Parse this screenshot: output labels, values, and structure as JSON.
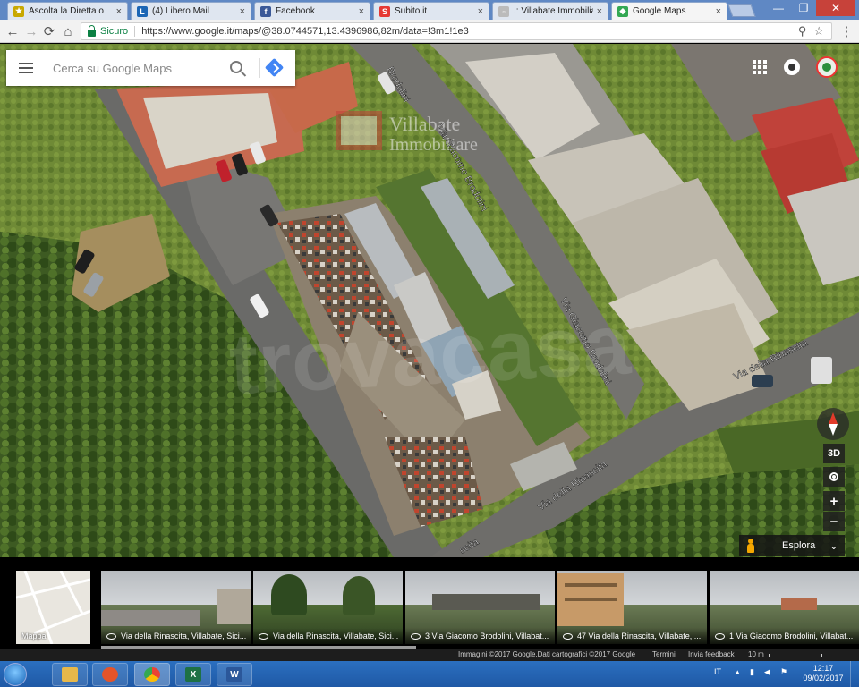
{
  "browser": {
    "tabs": [
      {
        "label": "Ascolta la Diretta o",
        "favicon_color": "#c8a800",
        "favicon_glyph": "★"
      },
      {
        "label": "(4) Libero Mail",
        "favicon_color": "#1c66b5",
        "favicon_glyph": "L"
      },
      {
        "label": "Facebook",
        "favicon_color": "#3b5998",
        "favicon_glyph": "f"
      },
      {
        "label": "Subito.it",
        "favicon_color": "#e53935",
        "favicon_glyph": "S"
      },
      {
        "label": ".: Villabate Immobilia",
        "favicon_color": "#bbbbbb",
        "favicon_glyph": "▫"
      },
      {
        "label": "Google Maps",
        "favicon_color": "#34a853",
        "favicon_glyph": "◆"
      }
    ],
    "tab_close_glyph": "×",
    "secure_label": "Sicuro",
    "url": "https://www.google.it/maps/@38.0744571,13.4396986,82m/data=!3m1!1e3",
    "window_controls": [
      "—",
      "❐",
      "✕"
    ],
    "nav": {
      "back": "←",
      "forward": "→",
      "reload": "⟳",
      "home": "⌂",
      "zoom": "⚲",
      "star": "☆",
      "menu": "⋮"
    }
  },
  "maps": {
    "search_placeholder": "Cerca su Google Maps",
    "street_labels": [
      "Brodolini",
      "Via Giacomo Brodolini",
      "Via Giacomo Brodolini",
      "Via della Rinascita",
      "Via della Rinascita",
      "scita"
    ],
    "controls": {
      "tilt_label": "3D",
      "zoom_in": "+",
      "zoom_out": "−",
      "explore_label": "Esplora",
      "explore_chevron": "⌄"
    },
    "imagery": [
      {
        "caption": "Mappa"
      },
      {
        "caption": "Via della Rinascita, Villabate, Sici..."
      },
      {
        "caption": "Via della Rinascita, Villabate, Sici..."
      },
      {
        "caption": "3 Via Giacomo Brodolini, Villabat..."
      },
      {
        "caption": "47 Via della Rinascita, Villabate, ..."
      },
      {
        "caption": "1 Via Giacomo Brodolini, Villabat..."
      }
    ],
    "footer": {
      "attribution": "Immagini ©2017 Google,Dati cartografici ©2017 Google",
      "terms": "Termini",
      "feedback": "Invia feedback",
      "scale": "10 m"
    }
  },
  "taskbar": {
    "apps": [
      {
        "name": "file-explorer",
        "color": "#e8b84a"
      },
      {
        "name": "media-player",
        "color": "#e4542a"
      },
      {
        "name": "chrome",
        "color": "#34a853"
      },
      {
        "name": "excel",
        "color": "#1e7145",
        "glyph": "X"
      },
      {
        "name": "word",
        "color": "#2b579a",
        "glyph": "W"
      }
    ],
    "language": "IT",
    "time": "12:17",
    "date": "09/02/2017"
  }
}
